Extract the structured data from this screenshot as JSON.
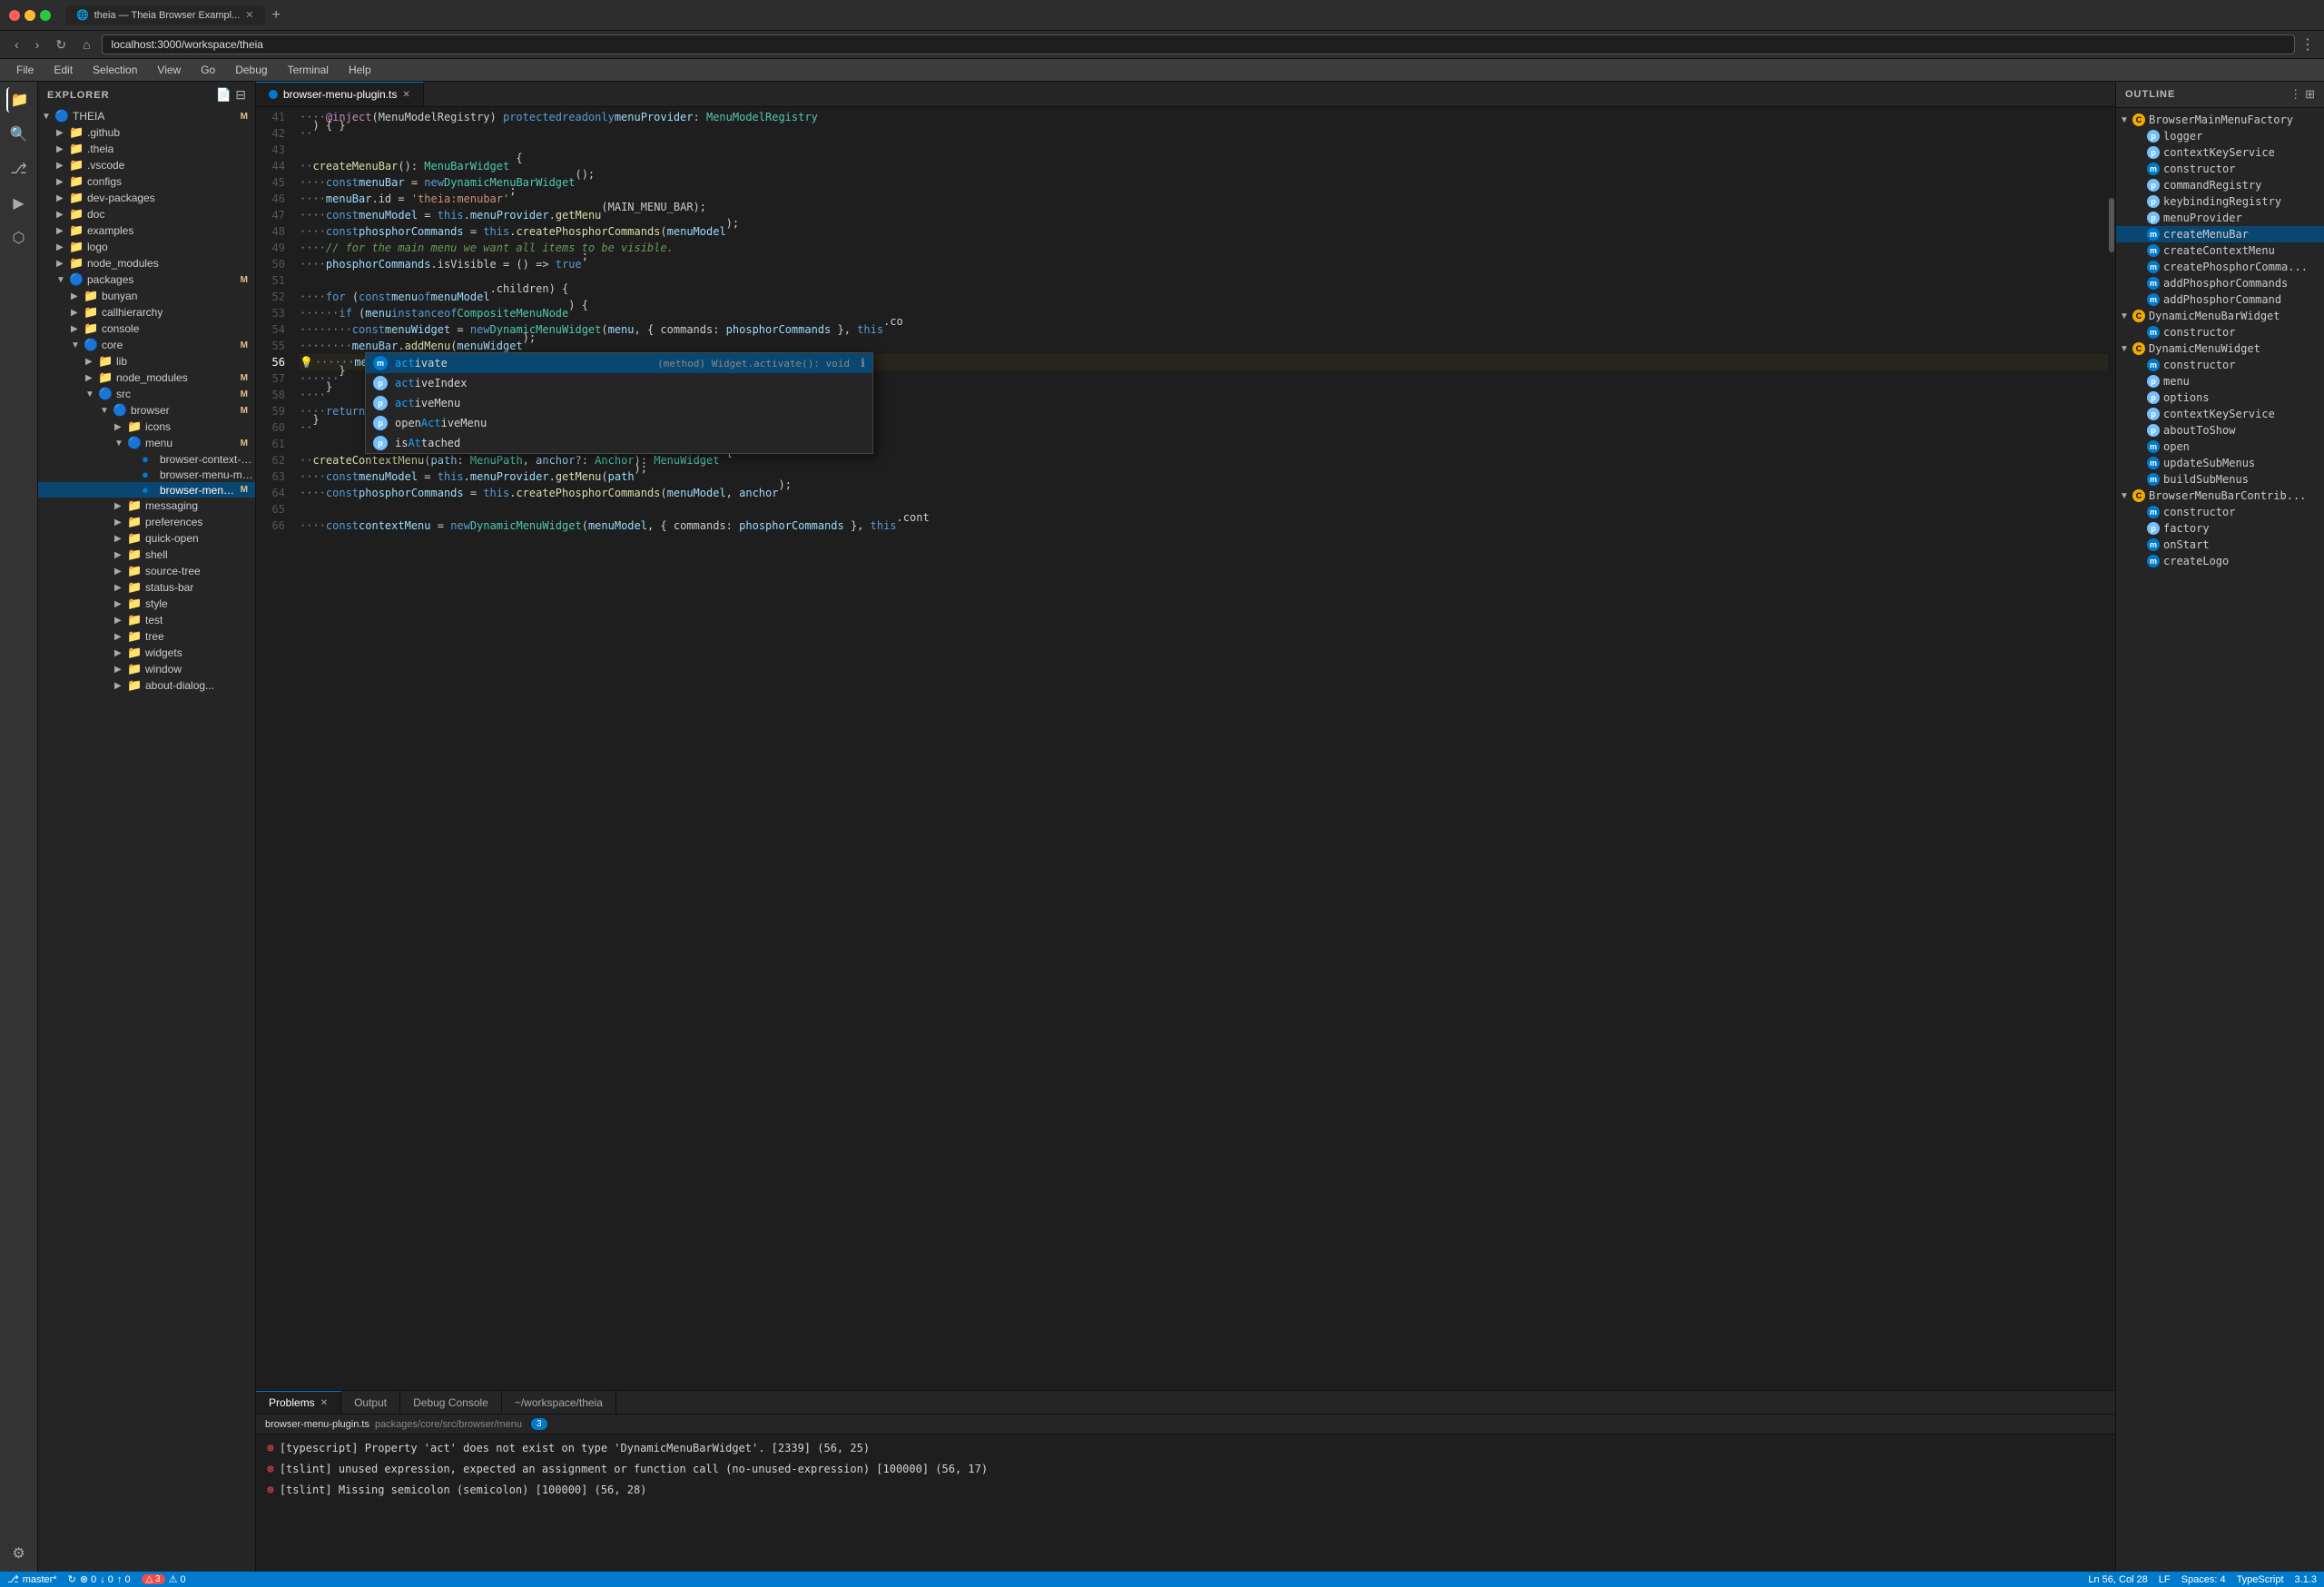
{
  "browser": {
    "tab_title": "theia — Theia Browser Exampl...",
    "address": "localhost:3000/workspace/theia",
    "new_tab_label": "+"
  },
  "menu": {
    "items": [
      "File",
      "Edit",
      "Selection",
      "View",
      "Go",
      "Debug",
      "Terminal",
      "Help"
    ]
  },
  "sidebar": {
    "title": "EXPLORER",
    "items": [
      {
        "label": "THEIA",
        "type": "folder",
        "depth": 0,
        "expanded": true,
        "badge": "M"
      },
      {
        "label": ".github",
        "type": "folder",
        "depth": 1,
        "expanded": false
      },
      {
        "label": ".theia",
        "type": "folder",
        "depth": 1,
        "expanded": false
      },
      {
        "label": ".vscode",
        "type": "folder",
        "depth": 1,
        "expanded": false
      },
      {
        "label": "configs",
        "type": "folder",
        "depth": 1,
        "expanded": false
      },
      {
        "label": "dev-packages",
        "type": "folder",
        "depth": 1,
        "expanded": false
      },
      {
        "label": "doc",
        "type": "folder",
        "depth": 1,
        "expanded": false
      },
      {
        "label": "examples",
        "type": "folder",
        "depth": 1,
        "expanded": false
      },
      {
        "label": "logo",
        "type": "folder",
        "depth": 1,
        "expanded": false
      },
      {
        "label": "node_modules",
        "type": "folder",
        "depth": 1,
        "expanded": false
      },
      {
        "label": "packages",
        "type": "folder",
        "depth": 1,
        "expanded": true,
        "badge": "M"
      },
      {
        "label": "bunyan",
        "type": "folder",
        "depth": 2,
        "expanded": false
      },
      {
        "label": "callhierarchy",
        "type": "folder",
        "depth": 2,
        "expanded": false
      },
      {
        "label": "console",
        "type": "folder",
        "depth": 2,
        "expanded": false
      },
      {
        "label": "core",
        "type": "folder",
        "depth": 2,
        "expanded": true,
        "badge": "M"
      },
      {
        "label": "lib",
        "type": "folder",
        "depth": 3,
        "expanded": false
      },
      {
        "label": "node_modules",
        "type": "folder",
        "depth": 3,
        "expanded": false,
        "badge": "M"
      },
      {
        "label": "src",
        "type": "folder",
        "depth": 3,
        "expanded": true,
        "badge": "M"
      },
      {
        "label": "browser",
        "type": "folder",
        "depth": 4,
        "expanded": true,
        "badge": "M"
      },
      {
        "label": "icons",
        "type": "folder",
        "depth": 5,
        "expanded": false
      },
      {
        "label": "menu",
        "type": "folder",
        "depth": 5,
        "expanded": true,
        "badge": "M"
      },
      {
        "label": "browser-context-menu-r...",
        "type": "file-ts",
        "depth": 6
      },
      {
        "label": "browser-menu-module.ts",
        "type": "file-ts",
        "depth": 6
      },
      {
        "label": "browser-menu-plugin.ts",
        "type": "file-ts-active",
        "depth": 6,
        "badge": "M",
        "selected": true
      },
      {
        "label": "messaging",
        "type": "folder",
        "depth": 4,
        "expanded": false
      },
      {
        "label": "preferences",
        "type": "folder",
        "depth": 4,
        "expanded": false
      },
      {
        "label": "quick-open",
        "type": "folder",
        "depth": 4,
        "expanded": false
      },
      {
        "label": "shell",
        "type": "folder",
        "depth": 4,
        "expanded": false
      },
      {
        "label": "source-tree",
        "type": "folder",
        "depth": 4,
        "expanded": false
      },
      {
        "label": "status-bar",
        "type": "folder",
        "depth": 4,
        "expanded": false
      },
      {
        "label": "style",
        "type": "folder",
        "depth": 4,
        "expanded": false
      },
      {
        "label": "test",
        "type": "folder",
        "depth": 4,
        "expanded": false
      },
      {
        "label": "tree",
        "type": "folder",
        "depth": 4,
        "expanded": false
      },
      {
        "label": "widgets",
        "type": "folder",
        "depth": 4,
        "expanded": false
      },
      {
        "label": "window",
        "type": "folder",
        "depth": 4,
        "expanded": false
      },
      {
        "label": "about-dialog...",
        "type": "folder",
        "depth": 4,
        "expanded": false
      }
    ]
  },
  "editor": {
    "tab_label": "browser-menu-plugin.ts",
    "breadcrumb": "packages/core/src/browser/menu",
    "lines": [
      {
        "num": 41,
        "code": "    @inject(MenuModelRegistry) protected readonly menuProvider: MenuModelRegistry"
      },
      {
        "num": 42,
        "code": "  ) { }"
      },
      {
        "num": 43,
        "code": ""
      },
      {
        "num": 44,
        "code": "  createMenuBar(): MenuBarWidget {"
      },
      {
        "num": 45,
        "code": "    const menuBar = new DynamicMenuBarWidget();"
      },
      {
        "num": 46,
        "code": "    menuBar.id = 'theia:menubar';"
      },
      {
        "num": 47,
        "code": "    const menuModel = this.menuProvider.getMenu(MAIN_MENU_BAR);"
      },
      {
        "num": 48,
        "code": "    const phosphorCommands = this.createPhosphorCommands(menuModel);"
      },
      {
        "num": 49,
        "code": "    // for the main menu we want all items to be visible."
      },
      {
        "num": 50,
        "code": "    phosphorCommands.isVisible = () => true;"
      },
      {
        "num": 51,
        "code": ""
      },
      {
        "num": 52,
        "code": "    for (const menu of menuModel.children) {"
      },
      {
        "num": 53,
        "code": "      if (menu instanceof CompositeMenuNode) {"
      },
      {
        "num": 54,
        "code": "        const menuWidget = new DynamicMenuWidget(menu, { commands: phosphorCommands }, this.co"
      },
      {
        "num": 55,
        "code": "        menuBar.addMenu(menuWidget);"
      },
      {
        "num": 56,
        "code": "        menuBar.act",
        "current": true
      },
      {
        "num": 57,
        "code": "      }"
      },
      {
        "num": 58,
        "code": "    }"
      },
      {
        "num": 59,
        "code": "    return menuBar;"
      },
      {
        "num": 60,
        "code": "  }"
      },
      {
        "num": 61,
        "code": ""
      },
      {
        "num": 62,
        "code": "  createContextMenu(path: MenuPath, anchor?: Anchor): MenuWidget {"
      },
      {
        "num": 63,
        "code": "    const menuModel = this.menuProvider.getMenu(path);"
      },
      {
        "num": 64,
        "code": "    const phosphorCommands = this.createPhosphorCommands(menuModel, anchor);"
      },
      {
        "num": 65,
        "code": ""
      },
      {
        "num": 66,
        "code": "    const contextMenu = new DynamicMenuWidget(menuModel, { commands: phosphorCommands }, this.cont"
      }
    ],
    "autocomplete": {
      "items": [
        {
          "icon": "method",
          "label": "activate",
          "match": "act",
          "type": "(method) Widget.activate(): void",
          "selected": true,
          "info": "ℹ"
        },
        {
          "icon": "property",
          "label": "activeIndex",
          "match": "act"
        },
        {
          "icon": "property",
          "label": "activeMenu",
          "match": "act"
        },
        {
          "icon": "property",
          "label": "openActiveMenu",
          "match": "act"
        },
        {
          "icon": "property",
          "label": "isAttached",
          "match": "A"
        }
      ]
    }
  },
  "outline": {
    "title": "OUTLINE",
    "items": [
      {
        "label": "BrowserMainMenuFactory",
        "type": "class",
        "depth": 0,
        "expanded": true
      },
      {
        "label": "logger",
        "type": "prop",
        "depth": 1
      },
      {
        "label": "contextKeyService",
        "type": "prop",
        "depth": 1
      },
      {
        "label": "constructor",
        "type": "method",
        "depth": 1
      },
      {
        "label": "commandRegistry",
        "type": "prop",
        "depth": 1
      },
      {
        "label": "keybindingRegistry",
        "type": "prop",
        "depth": 1
      },
      {
        "label": "menuProvider",
        "type": "prop",
        "depth": 1
      },
      {
        "label": "createMenuBar",
        "type": "method",
        "depth": 1,
        "selected": true
      },
      {
        "label": "createContextMenu",
        "type": "method",
        "depth": 1
      },
      {
        "label": "createPhosphorComma...",
        "type": "method",
        "depth": 1
      },
      {
        "label": "addPhosphorCommands",
        "type": "method",
        "depth": 1
      },
      {
        "label": "addPhosphorCommand",
        "type": "method",
        "depth": 1
      },
      {
        "label": "DynamicMenuBarWidget",
        "type": "class",
        "depth": 0,
        "expanded": true
      },
      {
        "label": "constructor",
        "type": "method",
        "depth": 1
      },
      {
        "label": "DynamicMenuWidget",
        "type": "class",
        "depth": 0,
        "expanded": true
      },
      {
        "label": "constructor",
        "type": "method",
        "depth": 1
      },
      {
        "label": "menu",
        "type": "prop",
        "depth": 1
      },
      {
        "label": "options",
        "type": "prop",
        "depth": 1
      },
      {
        "label": "contextKeyService",
        "type": "prop",
        "depth": 1
      },
      {
        "label": "aboutToShow",
        "type": "prop",
        "depth": 1
      },
      {
        "label": "open",
        "type": "method",
        "depth": 1
      },
      {
        "label": "updateSubMenus",
        "type": "method",
        "depth": 1
      },
      {
        "label": "buildSubMenus",
        "type": "method",
        "depth": 1
      },
      {
        "label": "BrowserMenuBarContrib...",
        "type": "class",
        "depth": 0,
        "expanded": true
      },
      {
        "label": "constructor",
        "type": "method",
        "depth": 1
      },
      {
        "label": "factory",
        "type": "prop",
        "depth": 1
      },
      {
        "label": "onStart",
        "type": "method",
        "depth": 1
      },
      {
        "label": "createLogo",
        "type": "method",
        "depth": 1
      }
    ]
  },
  "panel": {
    "tabs": [
      "Problems",
      "Output",
      "Debug Console",
      "~/workspace/theia"
    ],
    "active_tab": "Problems",
    "path_label": "browser-menu-plugin.ts",
    "path_full": "packages/core/src/browser/menu",
    "path_badge": "3",
    "problems": [
      {
        "text": "[typescript] Property 'act' does not exist on type 'DynamicMenuBarWidget'. [2339] (56, 25)"
      },
      {
        "text": "[tslint] unused expression, expected an assignment or function call (no-unused-expression) [100000] (56, 17)"
      },
      {
        "text": "[tslint] Missing semicolon (semicolon) [100000] (56, 28)"
      }
    ]
  },
  "status": {
    "branch": "master*",
    "sync": "↻",
    "errors": "⊗ 0",
    "warnings_down": "↓ 0",
    "warnings_up": "↑ 0",
    "alerts": "△ 3 ⚠ 0",
    "position": "Ln 56, Col 28",
    "line_ending": "LF",
    "spaces": "Spaces: 4",
    "language": "TypeScript",
    "version": "3.1.3"
  }
}
